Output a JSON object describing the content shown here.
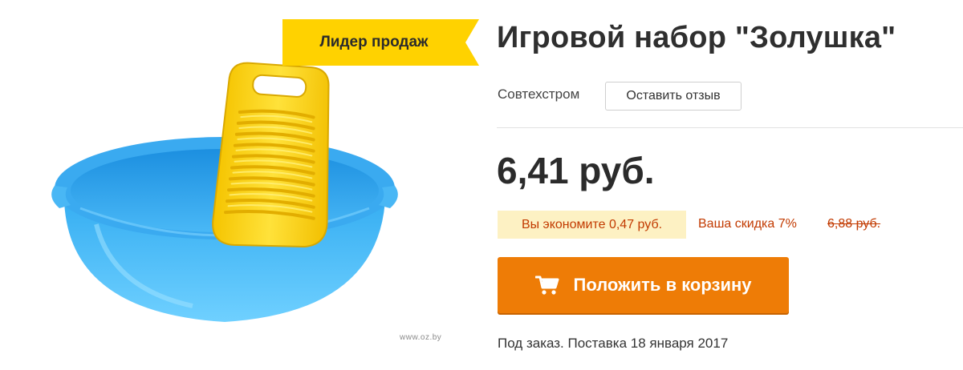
{
  "badge": {
    "label": "Лидер продаж",
    "color": "#ffd200"
  },
  "product": {
    "title": "Игровой набор \"Золушка\"",
    "brand": "Совтехстром",
    "review_button": "Оставить отзыв",
    "image_watermark": "www.oz.by",
    "image_icons": [
      "basin-icon",
      "washboard-icon"
    ]
  },
  "pricing": {
    "price": "6,41 руб.",
    "savings": "Вы экономите 0,47 руб.",
    "discount": "Ваша скидка 7%",
    "old_price": "6,88 руб."
  },
  "cart": {
    "label": "Положить в корзину",
    "icon": "cart-icon",
    "color": "#ee7c06"
  },
  "availability": "Под заказ. Поставка 18 января 2017",
  "colors": {
    "accent_text": "#c23a00",
    "savings_bg": "#fdf1c3"
  }
}
